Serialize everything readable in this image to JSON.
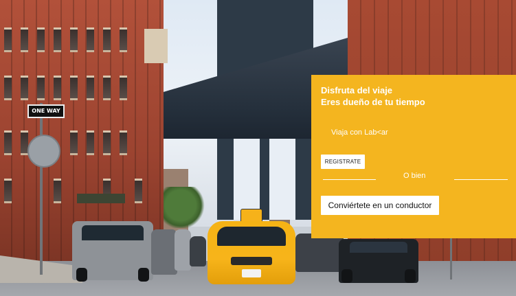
{
  "hero": {
    "headline_line1": "Disfruta del viaje",
    "headline_line2": "Eres dueño de tu tiempo",
    "tagline": "Viaja con Lab<ar",
    "register_label": "REGISTRATE",
    "separator_text": "O bien",
    "driver_label": "Conviértete en un conductor"
  },
  "scene": {
    "street_sign": "ONE WAY"
  },
  "colors": {
    "panel": "#f4b51f",
    "button_bg": "#ffffff",
    "text": "#ffffff"
  }
}
